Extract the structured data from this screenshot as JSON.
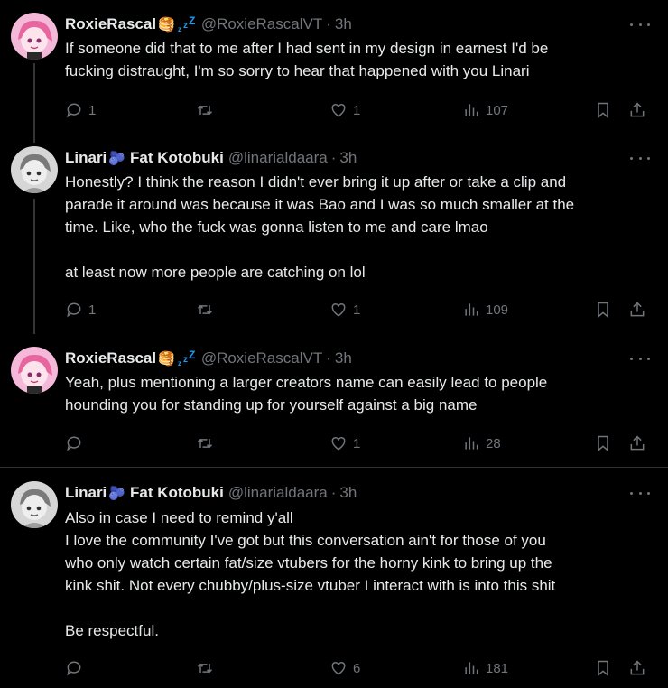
{
  "tweets": [
    {
      "name": "RoxieRascal",
      "emoji": "🥞",
      "handle": "@RoxieRascalVT",
      "time": "3h",
      "lines": [
        "If someone did that to me after I had sent in my design in earnest I'd be",
        "fucking distraught, I'm so sorry to hear that happened with you Linari"
      ],
      "replies": "1",
      "retweets": "",
      "likes": "1",
      "views": "107"
    },
    {
      "name": "Linari",
      "emoji": "🫐",
      "name2": "Fat Kotobuki",
      "handle": "@linarialdaara",
      "time": "3h",
      "lines": [
        "Honestly? I think the reason I didn't ever bring it up after or take a clip and",
        "parade it around was because it was Bao and I was so much smaller at the",
        "time. Like, who the fuck was gonna listen to me and care lmao",
        "",
        "at least now more people are catching on lol"
      ],
      "replies": "1",
      "retweets": "",
      "likes": "1",
      "views": "109"
    },
    {
      "name": "RoxieRascal",
      "emoji": "🥞",
      "handle": "@RoxieRascalVT",
      "time": "3h",
      "lines": [
        "Yeah, plus mentioning a larger creators name can easily lead to people",
        "hounding you for standing up for yourself against a big name"
      ],
      "replies": "",
      "retweets": "",
      "likes": "1",
      "views": "28"
    },
    {
      "name": "Linari",
      "emoji": "🫐",
      "name2": "Fat Kotobuki",
      "handle": "@linarialdaara",
      "time": "3h",
      "lines": [
        "Also in case I need to remind y'all",
        "I love the community I've got but this conversation ain't for those of you",
        "who only watch certain fat/size vtubers for the horny kink to bring up the",
        "kink shit. Not every chubby/plus-size vtuber I interact with is into this shit",
        "",
        "Be respectful."
      ],
      "replies": "",
      "retweets": "",
      "likes": "6",
      "views": "181"
    }
  ],
  "icons": {
    "reply": "reply-icon",
    "retweet": "retweet-icon",
    "like": "heart-icon",
    "views": "views-icon",
    "bookmark": "bookmark-icon",
    "share": "share-icon",
    "more": "more-icon",
    "sleep": "zzz-icon"
  },
  "colors": {
    "background": "#000000",
    "text": "#e7e9ea",
    "muted": "#71767b",
    "divider": "#2f3336",
    "sleep": "#1d9bf0"
  }
}
